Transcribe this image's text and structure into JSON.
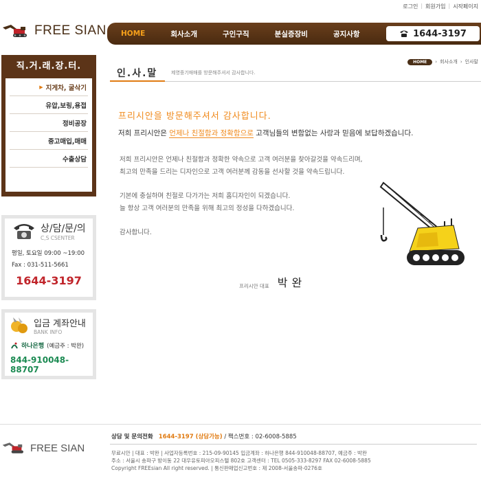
{
  "util": {
    "login": "로그인",
    "join": "회원가입",
    "home": "시작페이지"
  },
  "brand": {
    "name": "FREE SIAN"
  },
  "nav": {
    "items": [
      "HOME",
      "회사소개",
      "구인구직",
      "분실증장비",
      "공지사항"
    ],
    "phone": "1644-3197"
  },
  "sidebar": {
    "title": "직.거.래.장.터.",
    "items": [
      "지게차, 굴삭기",
      "유압,보링,용접",
      "정비공장",
      "중고매입,매매",
      "수출상담"
    ]
  },
  "cs": {
    "title": "상/담/문/의",
    "subtitle": "C,S CSENTER",
    "hours": "평일, 토요일 09:00 ~19:00",
    "fax": "Fax :  031-511-5661",
    "tel": "1644-3197"
  },
  "bank": {
    "title": "입금 계좌안내",
    "subtitle": "BANK INFO",
    "bank_name": "하나은행",
    "holder": "(예금주 : 박완)",
    "account": "844-910048-88707"
  },
  "content": {
    "title": "인.사.말",
    "subtitle": "제영중기매매를 방문해주셔서 감사합니다.",
    "breadcrumb": [
      "HOME",
      "회사소개",
      "인사말"
    ],
    "hand_line1": "프리시안을  방문해주셔서  감사합니다.",
    "hand_line2_pre": "저희  프리시안은 ",
    "hand_line2_hl": "언제나 친절함과 정확함으로",
    "hand_line2_post": " 고객님들의 변함없는 사랑과 믿음에 보답하겠습니다.",
    "para1_l1": "저희  프리시안은  언제나 친절함과 정확한 약속으로  고객 여러분을 찾아갈것을 약속드리며,",
    "para1_l2": "최고의 만족을 드리는 디자인으로  고객 여러분께 감동을 선사할 것을 약속드립니다.",
    "para2_l1": "기본에 충실하며 친절로 다가가는 저희 홈디자인이 되겠습니다.",
    "para2_l2": "늘 항상 고객 여러분의 만족을 위해 최고의 정성을 다하겠습니다.",
    "thanks": "감사합니다.",
    "sign_label": "프리시안 대표",
    "sign_name": "박완"
  },
  "footer": {
    "contact_label": "상담 및 문의전화",
    "contact_tel": "1644-3197 (상담가능)",
    "contact_fax": "/  팩스번호 : 02-6008-5885",
    "line1": "무료시안  |  대표 : 박완  |  사업자등록번호 : 215-09-90145  입금계좌 : 하나은행 844-910048-88707, 예금주 : 박완",
    "line2": "주소 : 서울시 송파구 방이동 22 대우유토피아오피스텔 802호  고객센터 : TEL 0505-333-8297     FAX 02-6008-5885",
    "line3": "Copyright FREEsian All right reserved.  |  통신판매업신고번호 : 제 2008-서울송파-0276호"
  },
  "colors": {
    "brown": "#5c3418",
    "orange": "#f08a1c",
    "red": "#c0242a",
    "green": "#1b8a52"
  }
}
